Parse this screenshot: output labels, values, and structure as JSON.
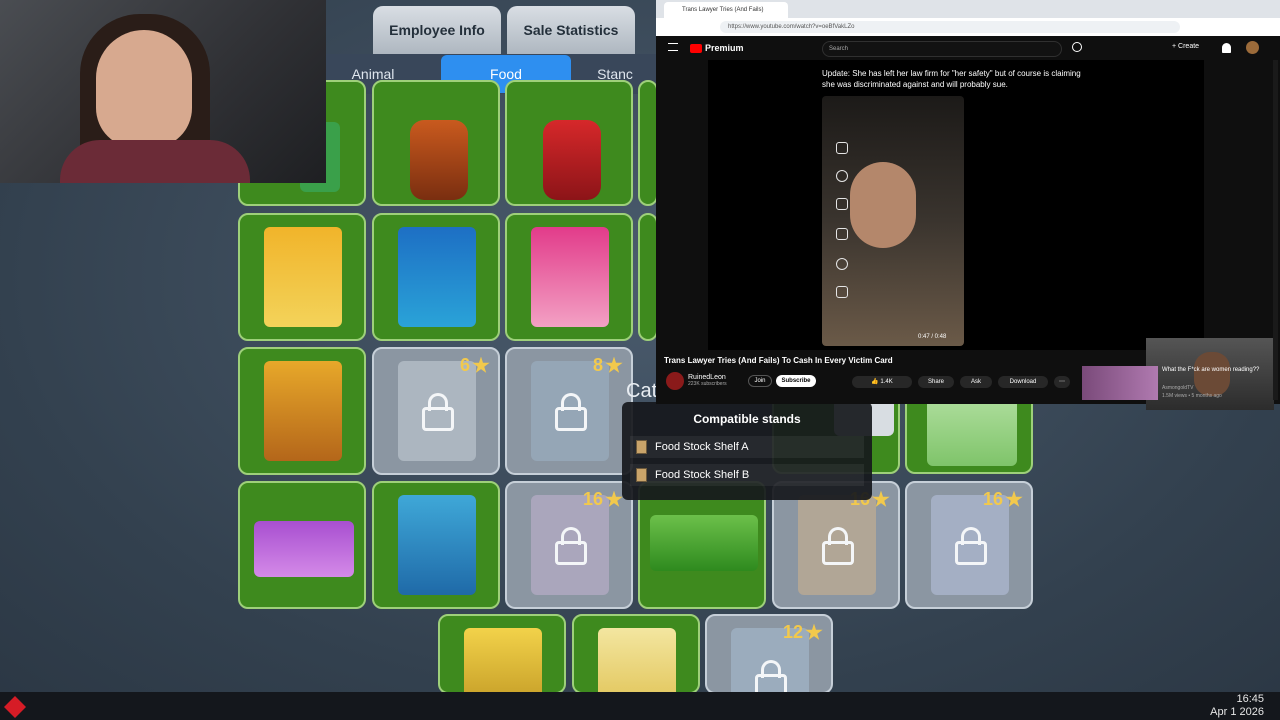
{
  "game": {
    "top_tabs": [
      "Employee Info",
      "Sale Statistics"
    ],
    "sub_tabs": [
      "Animal",
      "Food",
      "Stanc"
    ],
    "active_sub_tab": "Food",
    "tooltip": {
      "partial_text": "Cat",
      "title": "Compatible stands",
      "stands": [
        "Food Stock Shelf A",
        "Food Stock Shelf B"
      ]
    },
    "prices": [
      "6",
      "8",
      "16",
      "16",
      "16",
      "12"
    ],
    "colors": {
      "tile_green": "#3e8a1e",
      "tab_active": "#2e8ff0",
      "coin": "#f2c94c"
    }
  },
  "browser": {
    "tab_title": "Trans Lawyer Tries (And Fails)",
    "url": "https://www.youtube.com/watch?v=oeBfVakLZo",
    "yt_brand": "Premium",
    "search_placeholder": "Search",
    "create_label": "Create",
    "caption": "Update: She has left her law firm for \"her safety\" but of course is claiming she was discriminated against and will probably sue.",
    "time": "0:47 / 0:48",
    "video_title": "Trans Lawyer Tries (And Fails) To Cash In Every Victim Card",
    "channel": "RuinedLeon",
    "subscribers": "223K subscribers",
    "join": "Join",
    "subscribe": "Subscribe",
    "likes": "1.4K",
    "share": "Share",
    "ask": "Ask",
    "download": "Download",
    "rec_title": "What the F*ck are women reading??",
    "rec_channel": "AsmongoldTV",
    "rec_meta": "1.5M views • 5 months ago"
  },
  "taskbar": {
    "time": "16:45",
    "date": "Apr 1 2026"
  }
}
